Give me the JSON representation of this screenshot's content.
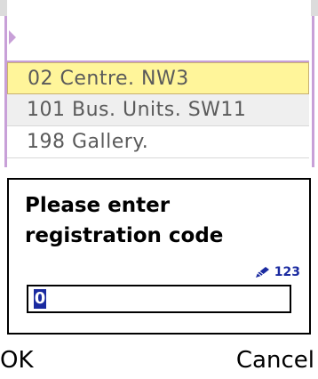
{
  "list": {
    "items": [
      {
        "label": "02 Centre. NW3",
        "selected": true
      },
      {
        "label": "101 Bus. Units. SW11",
        "selected": false
      },
      {
        "label": "198 Gallery.",
        "selected": false
      }
    ]
  },
  "dialog": {
    "prompt_line1": "Please enter",
    "prompt_line2": "registration code",
    "input_mode": "123",
    "input_mode_icon": "pen-icon",
    "input_value": "0"
  },
  "softkeys": {
    "left": "OK",
    "right": "Cancel"
  },
  "colors": {
    "selection": "#fff59a",
    "frame_accent": "#c8a0d8",
    "indicator": "#1a2aa0"
  }
}
